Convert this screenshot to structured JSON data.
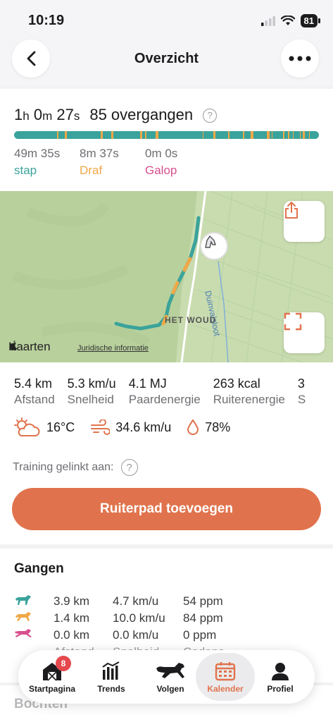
{
  "status_bar": {
    "time": "10:19",
    "battery": "81"
  },
  "header": {
    "title": "Overzicht"
  },
  "summary": {
    "duration_h": "1",
    "duration_h_unit": "h",
    "duration_m": " 0",
    "duration_m_unit": "m",
    "duration_s": " 27",
    "duration_s_unit": "s",
    "transitions": "85 overgangen",
    "help_symbol": "?",
    "gaits": [
      {
        "time": "49m 35s",
        "name": "stap",
        "color": "#3aa39b"
      },
      {
        "time": "8m 37s",
        "name": "Draf",
        "color": "#f0a848"
      },
      {
        "time": "0m 0s",
        "name": "Galop",
        "color": "#d84f8e"
      }
    ]
  },
  "map": {
    "brand": "Kaarten",
    "legal": "Juridische informatie",
    "label_woud": "HET WOUD",
    "label_sloot": "Duinvalsloot",
    "accent": "#e0734d"
  },
  "stats": [
    {
      "value": "5.4 km",
      "label": "Afstand"
    },
    {
      "value": "5.3 km/u",
      "label": "Snelheid"
    },
    {
      "value": "4.1 MJ",
      "label": "Paardenergie"
    },
    {
      "value": "263 kcal",
      "label": "Ruiterenergie"
    },
    {
      "value": "3",
      "label": "S"
    }
  ],
  "weather": {
    "temperature": "16°C",
    "wind": "34.6 km/u",
    "humidity": "78%"
  },
  "training": {
    "linked_label": "Training gelinkt aan:",
    "help_symbol": "?"
  },
  "cta": {
    "label": "Ruiterpad toevoegen"
  },
  "gangen": {
    "title": "Gangen",
    "rows": [
      {
        "icon": "horse-walk-icon",
        "color": "#3aa39b",
        "distance": "3.9 km",
        "speed": "4.7 km/u",
        "rate": "54 ppm"
      },
      {
        "icon": "horse-trot-icon",
        "color": "#f0a848",
        "distance": "1.4 km",
        "speed": "10.0 km/u",
        "rate": "84 ppm"
      },
      {
        "icon": "horse-gallop-icon",
        "color": "#d84f8e",
        "distance": "0.0 km",
        "speed": "0.0 km/u",
        "rate": "0 ppm"
      }
    ],
    "hidden_row": {
      "distance": "Afstand",
      "speed": "Snelheid",
      "rate": "Cadans"
    }
  },
  "next_section": {
    "title": "Bochten"
  },
  "tabbar": {
    "tabs": [
      {
        "label": "Startpagina",
        "icon": "barn-icon",
        "badge": "8"
      },
      {
        "label": "Trends",
        "icon": "trends-icon"
      },
      {
        "label": "Volgen",
        "icon": "horse-icon"
      },
      {
        "label": "Kalender",
        "icon": "calendar-icon",
        "active": true
      },
      {
        "label": "Profiel",
        "icon": "profile-icon"
      }
    ]
  }
}
